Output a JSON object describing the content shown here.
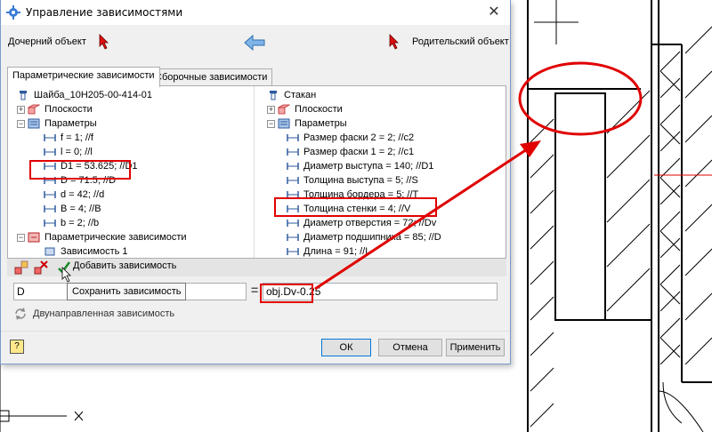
{
  "window": {
    "title": "Управление зависимостями",
    "close_glyph": "✕",
    "child_label": "Дочерний объект",
    "parent_label": "Родительский объект"
  },
  "tabs": [
    {
      "label": "Параметрические зависимости",
      "active": true
    },
    {
      "label": "Сборочные зависимости",
      "active": false
    }
  ],
  "left_tree": {
    "root": "Шайба_10Н205-00-414-01",
    "planes": "Плоскости",
    "params": "Параметры",
    "items": [
      "f = 1; //f",
      "l = 0; //l",
      "D1 = 53.625; //D1",
      "D = 71.5; //D",
      "d = 42; //d",
      "B = 4; //B",
      "b = 2; //b"
    ],
    "dependencies": "Параметрические зависимости",
    "dependency_1": "Зависимость 1"
  },
  "right_tree": {
    "root": "Стакан",
    "planes": "Плоскости",
    "params": "Параметры",
    "items": [
      "Размер фаски 2 = 2; //c2",
      "Размер фаски 1 = 2; //c1",
      "Диаметр выступа = 140; //D1",
      "Толщина выступа = 5; //S",
      "Толщина бордера = 5; //T",
      "Толщина стенки = 4; //V",
      "Диаметр отверстия = 72; //Dv",
      "Диаметр подшипника = 85; //D",
      "Длина = 91; //L"
    ]
  },
  "toolbar": {
    "add_dependency": "Добавить зависимость",
    "tooltip": "Сохранить зависимость"
  },
  "editor": {
    "left_value": "D",
    "right_value": "obj.Dv-0.25"
  },
  "bidirectional_label": "Двунаправленная зависимость",
  "buttons": {
    "ok": "ОК",
    "cancel": "Отмена",
    "apply": "Применить"
  },
  "colors": {
    "highlight": "#e00000",
    "accent": "#0078d7",
    "tree_icon": "#2f5a9e"
  },
  "icons": {
    "app": "gear-icon",
    "nav_arrow": "arrow-left-icon",
    "parameter": "dimension-icon",
    "folder_params": "parameters-icon",
    "planes": "planes-icon",
    "save": "checkmark-icon"
  }
}
